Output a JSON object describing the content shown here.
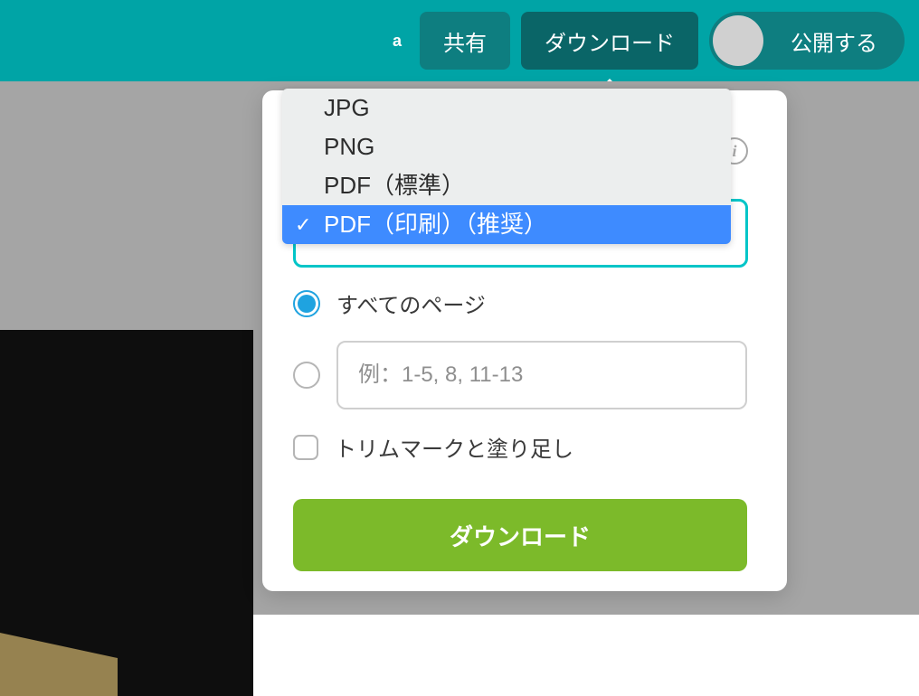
{
  "toolbar": {
    "prefix": "a",
    "share_label": "共有",
    "download_label": "ダウンロード",
    "publish_label": "公開する"
  },
  "dropdown": {
    "items": [
      {
        "label": "JPG",
        "selected": false
      },
      {
        "label": "PNG",
        "selected": false
      },
      {
        "label": "PDF（標準）",
        "selected": false
      },
      {
        "label": "PDF（印刷）（推奨）",
        "selected": true
      }
    ]
  },
  "options": {
    "all_pages_label": "すべてのページ",
    "range_placeholder": "例：1-5, 8, 11-13",
    "trim_label": "トリムマークと塗り足し",
    "download_button": "ダウンロード"
  }
}
